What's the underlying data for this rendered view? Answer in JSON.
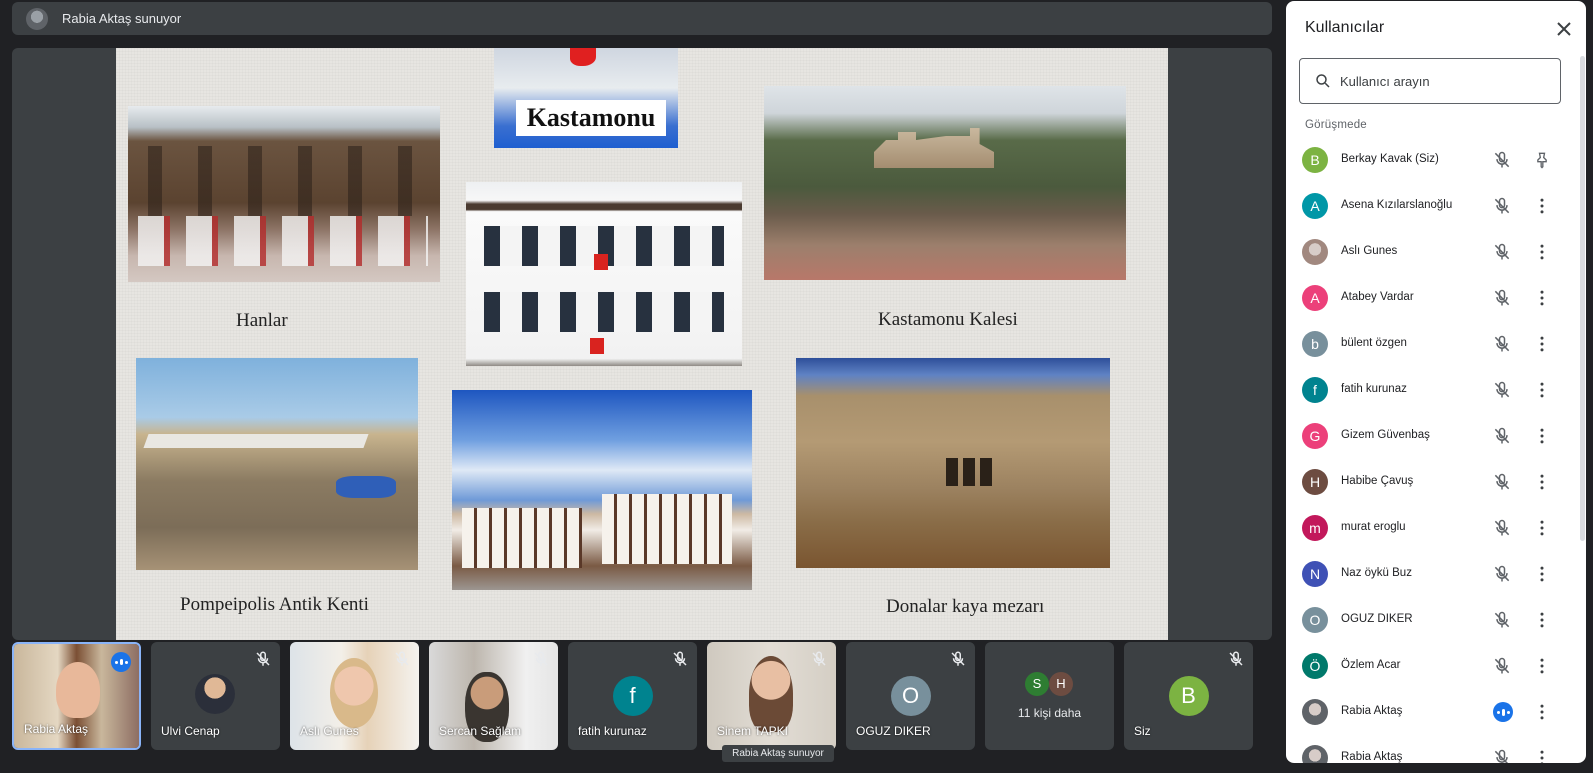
{
  "presenter_bar": {
    "text": "Rabia Aktaş sunuyor"
  },
  "slide": {
    "map_label": "Kastamonu",
    "captions": {
      "hanlar": "Hanlar",
      "kale": "Kastamonu Kalesi",
      "antik": "Pompeipolis Antik Kenti",
      "mezar": "Donalar kaya mezarı"
    }
  },
  "tiles": [
    {
      "name": "Rabia Aktaş",
      "speaking": true
    },
    {
      "name": "Ulvi Cenap"
    },
    {
      "name": "Aslı Gunes"
    },
    {
      "name": "Sercan Sağlam"
    },
    {
      "name": "fatih kurunaz",
      "initial": "f",
      "color": "#00838f"
    },
    {
      "name": "Sinem TAPKI"
    },
    {
      "name": "OGUZ DIKER",
      "initial": "O",
      "color": "#78909c"
    },
    {
      "more_label": "11 kişi daha",
      "initials": [
        "S",
        "H"
      ],
      "colors": [
        "#2e7d32",
        "#6d4c41"
      ]
    },
    {
      "name": "Siz",
      "initial": "B",
      "color": "#7cb342"
    }
  ],
  "tooltip": "Rabia Aktaş sunuyor",
  "panel": {
    "title": "Kullanıcılar",
    "search_placeholder": "Kullanıcı arayın",
    "section": "Görüşmede",
    "people": [
      {
        "initial": "B",
        "name": "Berkay Kavak (Siz)",
        "color": "#7cb342"
      },
      {
        "initial": "A",
        "name": "Asena Kızılarslanoğlu",
        "color": "#0097a7"
      },
      {
        "initial": "",
        "name": "Aslı Gunes",
        "color": "#a1887f"
      },
      {
        "initial": "A",
        "name": "Atabey Vardar",
        "color": "#ec407a"
      },
      {
        "initial": "b",
        "name": "bülent özgen",
        "color": "#78909c"
      },
      {
        "initial": "f",
        "name": "fatih kurunaz",
        "color": "#00838f"
      },
      {
        "initial": "G",
        "name": "Gizem Güvenbaş",
        "color": "#ec407a"
      },
      {
        "initial": "H",
        "name": "Habibe Çavuş",
        "color": "#6d4c41"
      },
      {
        "initial": "m",
        "name": "murat eroglu",
        "color": "#c2185b"
      },
      {
        "initial": "N",
        "name": "Naz öykü Buz",
        "color": "#3f51b5"
      },
      {
        "initial": "O",
        "name": "OGUZ DIKER",
        "color": "#78909c"
      },
      {
        "initial": "Ö",
        "name": "Özlem Acar",
        "color": "#00796b"
      },
      {
        "initial": "",
        "name": "Rabia Aktaş",
        "color": "#5f6368"
      },
      {
        "initial": "",
        "name": "Rabia Aktaş",
        "color": "#5f6368"
      }
    ]
  }
}
